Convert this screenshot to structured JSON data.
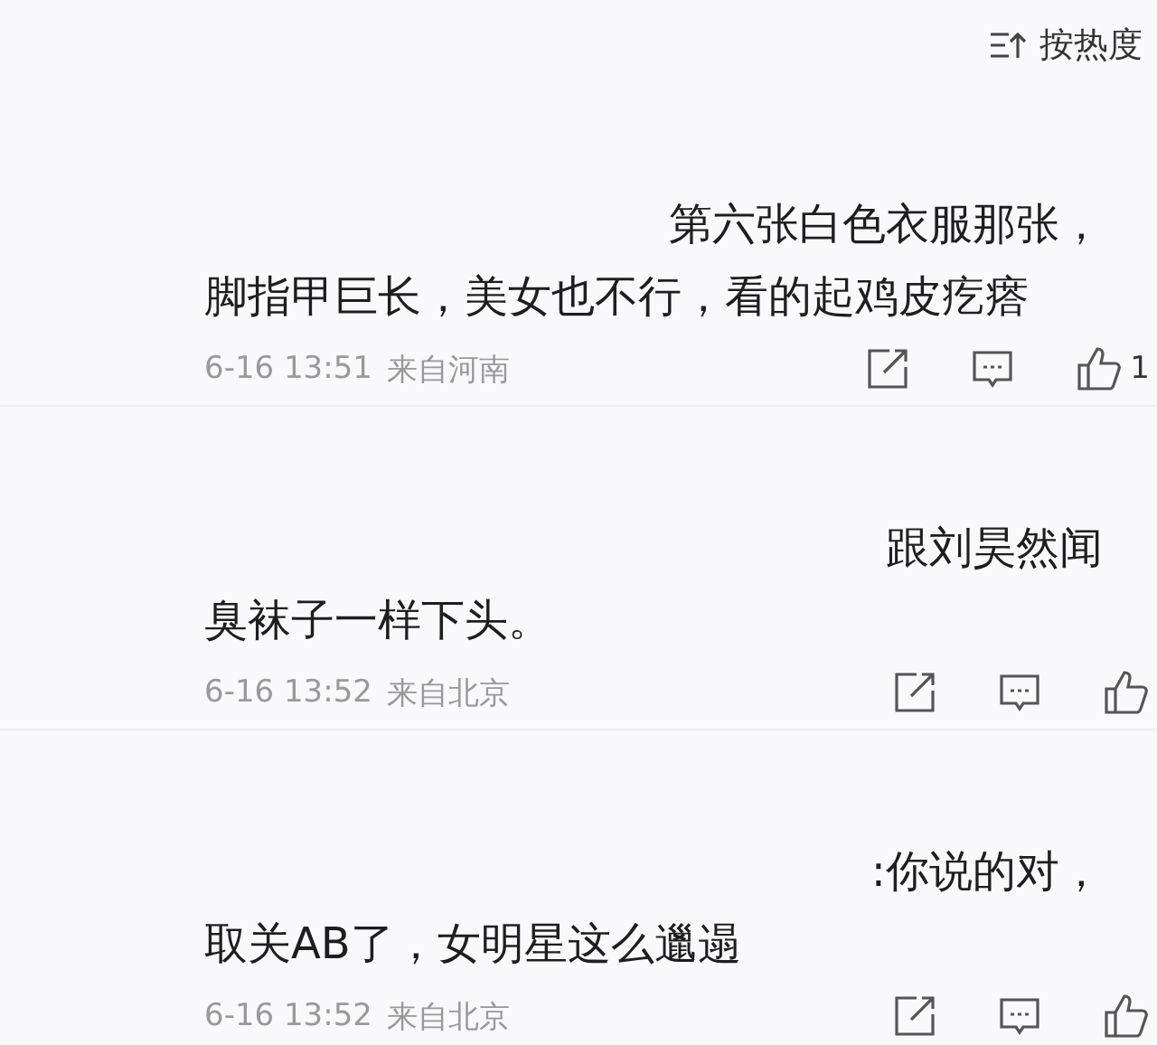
{
  "sort": {
    "label": "按热度"
  },
  "comments": [
    {
      "lines": [
        "第六张白色衣服那张，",
        "脚指甲巨长，美女也不行，看的起鸡皮疙瘩"
      ],
      "time": "6-16 13:51",
      "location": "来自河南",
      "likes": "1"
    },
    {
      "lines": [
        "跟刘昊然闻",
        "臭袜子一样下头。"
      ],
      "time": "6-16 13:52",
      "location": "来自北京"
    },
    {
      "lines": [
        ":你说的对，",
        "取关AB了，女明星这么邋遢"
      ],
      "time": "6-16 13:52",
      "location": "来自北京"
    }
  ]
}
